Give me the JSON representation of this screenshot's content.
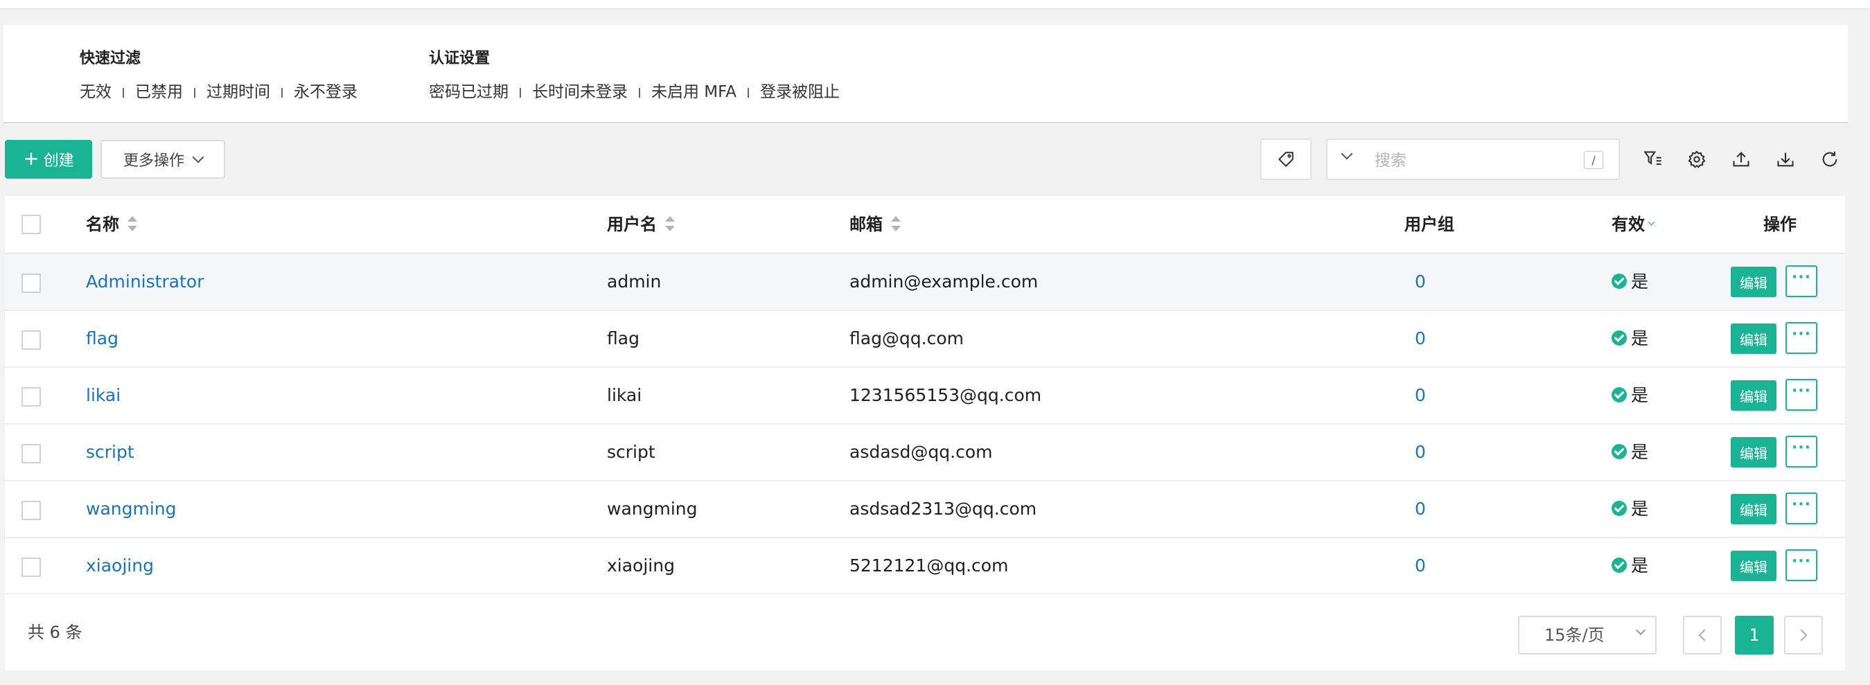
{
  "filters": {
    "quick": {
      "title": "快速过滤",
      "items": [
        "无效",
        "已禁用",
        "过期时间",
        "永不登录"
      ]
    },
    "auth": {
      "title": "认证设置",
      "items": [
        "密码已过期",
        "长时间未登录",
        "未启用 MFA",
        "登录被阻止"
      ]
    }
  },
  "toolbar": {
    "create_label": "创建",
    "more_label": "更多操作",
    "search_placeholder": "搜索",
    "search_shortcut": "/"
  },
  "table": {
    "columns": {
      "name": "名称",
      "username": "用户名",
      "email": "邮箱",
      "groups": "用户组",
      "valid": "有效",
      "actions": "操作"
    },
    "edit_label": "编辑",
    "more_label": "···",
    "rows": [
      {
        "name": "Administrator",
        "username": "admin",
        "email": "admin@example.com",
        "groups": "0",
        "valid": "是"
      },
      {
        "name": "flag",
        "username": "flag",
        "email": "flag@qq.com",
        "groups": "0",
        "valid": "是"
      },
      {
        "name": "likai",
        "username": "likai",
        "email": "1231565153@qq.com",
        "groups": "0",
        "valid": "是"
      },
      {
        "name": "script",
        "username": "script",
        "email": "asdasd@qq.com",
        "groups": "0",
        "valid": "是"
      },
      {
        "name": "wangming",
        "username": "wangming",
        "email": "asdsad2313@qq.com",
        "groups": "0",
        "valid": "是"
      },
      {
        "name": "xiaojing",
        "username": "xiaojing",
        "email": "5212121@qq.com",
        "groups": "0",
        "valid": "是"
      }
    ]
  },
  "footer": {
    "total": "共 6 条",
    "page_size": "15条/页",
    "current_page": "1"
  },
  "colors": {
    "accent": "#1ab394",
    "link": "#1a73b8"
  },
  "icons": [
    "plus-icon",
    "chevron-down-icon",
    "tag-icon",
    "filter-icon",
    "settings-icon",
    "upload-icon",
    "download-icon",
    "refresh-icon",
    "check-circle-icon"
  ]
}
